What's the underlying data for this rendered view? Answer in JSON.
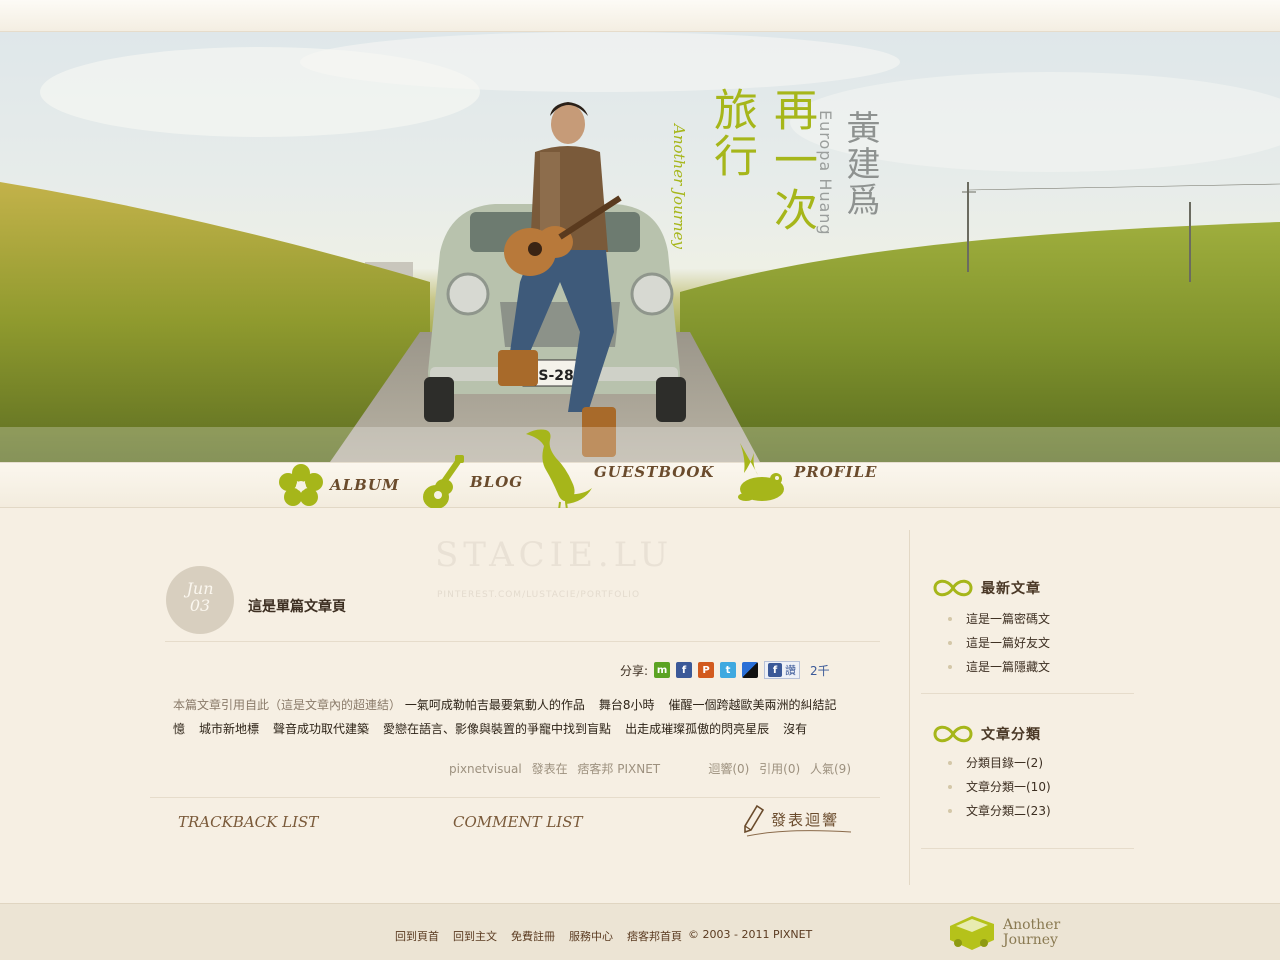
{
  "banner": {
    "title_line1": "旅行",
    "title_line2": "再一次",
    "title_en": "Another Journey",
    "artist_zh": "黃建爲",
    "artist_en": "Europa Huang",
    "plate": "MS-287"
  },
  "nav": {
    "items": [
      {
        "label": "ALBUM",
        "icon": "hibiscus-icon"
      },
      {
        "label": "BLOG",
        "icon": "guitar-icon"
      },
      {
        "label": "GUESTBOOK",
        "icon": "heron-icon"
      },
      {
        "label": "PROFILE",
        "icon": "frog-icon"
      }
    ]
  },
  "watermark": {
    "main": "STACIE.LU",
    "sub": "PINTEREST.COM/LUSTACIE/PORTFOLIO"
  },
  "post": {
    "date_month": "Jun",
    "date_day": "03",
    "title": "這是單篇文章頁",
    "share_label": "分享:",
    "share_icons": [
      "plurk-icon",
      "facebook-icon",
      "funp-icon",
      "twitter-icon",
      "delicious-icon"
    ],
    "like_label": "讚",
    "like_count": "2千",
    "body_intro": "本篇文章引用自此（這是文章內的超連結）",
    "body_links": [
      "一氣呵成勒帕吉最要氣動人的作品",
      "舞台8小時",
      "催醒一個跨越歐美兩洲的糾結記憶",
      "城市新地標",
      "聲音成功取代建築",
      "愛戀在語言、影像與裝置的爭寵中找到盲點",
      "出走成璀璨孤傲的閃亮星辰",
      "沒有"
    ],
    "meta_author": "pixnetvisual",
    "meta_posted": "發表在",
    "meta_site": "痞客邦 PIXNET",
    "meta_comments": "迴響(0)",
    "meta_trackback": "引用(0)",
    "meta_views": "人氣(9)",
    "trackback_label": "TRACKBACK LIST",
    "comment_label": "COMMENT LIST",
    "comment_button": "發表迴響"
  },
  "sidebar": {
    "latest_title": "最新文章",
    "latest_items": [
      "這是一篇密碼文",
      "這是一篇好友文",
      "這是一篇隱藏文"
    ],
    "category_title": "文章分類",
    "category_items": [
      "分類目錄一(2)",
      "文章分類一(10)",
      "文章分類二(23)"
    ]
  },
  "footer": {
    "links": [
      "回到頁首",
      "回到主文",
      "免費註冊",
      "服務中心",
      "痞客邦首頁"
    ],
    "copyright": "© 2003 - 2011 PIXNET",
    "logo_text_1": "Another",
    "logo_text_2": "Journey"
  },
  "colors": {
    "accent_green": "#a6b61a",
    "brown_text": "#6a4b2c",
    "background": "#f5efe4"
  }
}
